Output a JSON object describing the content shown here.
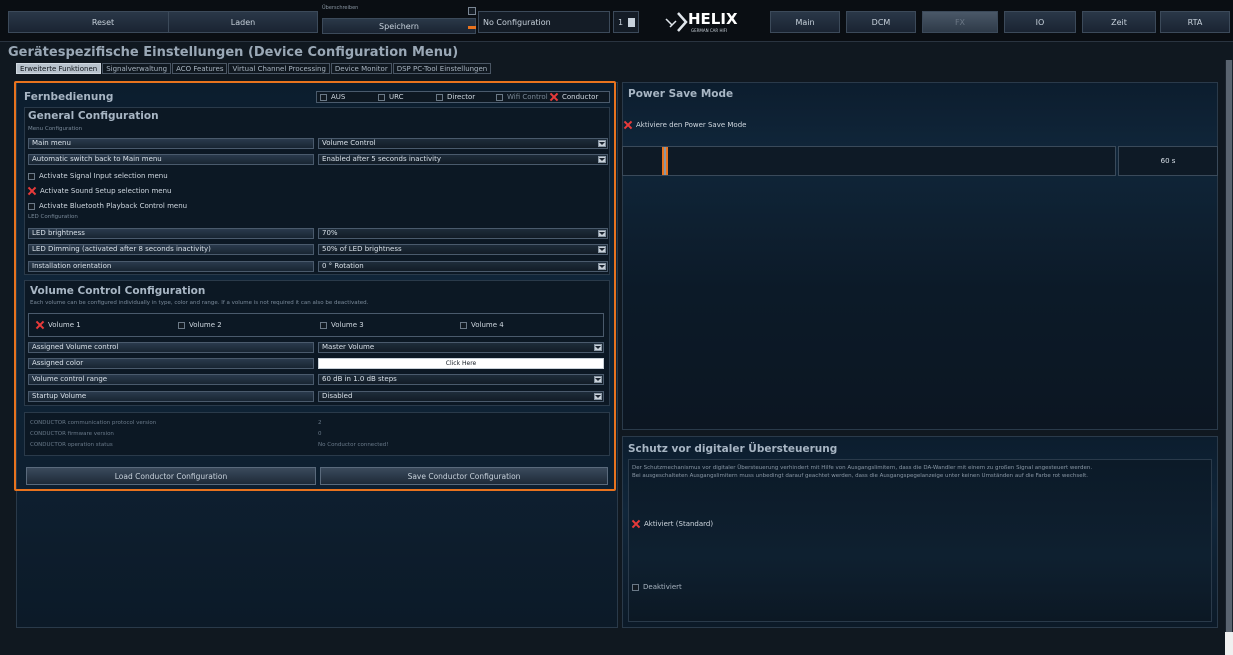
{
  "toolbar": {
    "reset": "Reset",
    "laden": "Laden",
    "overwrite_label": "Überschreiben",
    "speichern": "Speichern",
    "config_name": "No Configuration",
    "config_number": "1",
    "logo_main": "HELIX",
    "logo_sub": "GERMAN CAR HIFI",
    "nav": [
      "Main",
      "DCM",
      "FX",
      "IO",
      "Zeit",
      "RTA"
    ]
  },
  "page_title": "Gerätespezifische Einstellungen (Device Configuration Menu)",
  "tabs": [
    "Erweiterte Funktionen",
    "Signalverwaltung",
    "ACO Features",
    "Virtual Channel Processing",
    "Device Monitor",
    "DSP PC-Tool Einstellungen"
  ],
  "remote": {
    "title": "Fernbedienung",
    "options": [
      {
        "label": "AUS",
        "checked": false
      },
      {
        "label": "URC",
        "checked": false
      },
      {
        "label": "Director",
        "checked": false
      },
      {
        "label": "Wifi Control",
        "checked": false
      },
      {
        "label": "Conductor",
        "checked": true
      }
    ]
  },
  "general": {
    "title": "General Configuration",
    "menu_sub": "Menu Configuration",
    "rows": [
      {
        "label": "Main menu",
        "value": "Volume Control"
      },
      {
        "label": "Automatic switch back to Main menu",
        "value": "Enabled after 5 seconds inactivity"
      }
    ],
    "checks": [
      {
        "label": "Activate Signal Input selection menu",
        "checked": false
      },
      {
        "label": "Activate Sound Setup selection menu",
        "checked": true
      },
      {
        "label": "Activate Bluetooth Playback Control menu",
        "checked": false
      }
    ],
    "led_sub": "LED Configuration",
    "led_rows": [
      {
        "label": "LED brightness",
        "value": "70%"
      },
      {
        "label": "LED Dimming (activated after 8 seconds inactivity)",
        "value": "50% of LED brightness"
      },
      {
        "label": "Installation orientation",
        "value": "0 ° Rotation"
      }
    ]
  },
  "volume": {
    "title": "Volume Control Configuration",
    "sub": "Each volume can be configured individually in type, color and range. If a volume is not required it can also be deactivated.",
    "volumes": [
      {
        "label": "Volume 1",
        "checked": true
      },
      {
        "label": "Volume 2",
        "checked": false
      },
      {
        "label": "Volume 3",
        "checked": false
      },
      {
        "label": "Volume 4",
        "checked": false
      }
    ],
    "assigned_control_label": "Assigned Volume control",
    "assigned_control_value": "Master Volume",
    "assigned_color_label": "Assigned color",
    "assigned_color_value": "Click Here",
    "range_label": "Volume control range",
    "range_value": "60 dB in 1.0 dB steps",
    "startup_label": "Startup Volume",
    "startup_value": "Disabled"
  },
  "conductor_info": {
    "protocol_label": "CONDUCTOR communication protocol version",
    "protocol_value": "2",
    "firmware_label": "CONDUCTOR firmware version",
    "firmware_value": "0",
    "status_label": "CONDUCTOR operation status",
    "status_value": "No Conductor connected!"
  },
  "buttons": {
    "load": "Load Conductor Configuration",
    "save": "Save Conductor Configuration"
  },
  "power_save": {
    "title": "Power Save Mode",
    "activate_label": "Aktiviere den Power Save Mode",
    "activate_checked": true,
    "slider_value": "60 s",
    "slider_fraction": 0.08
  },
  "overdrive": {
    "title": "Schutz vor digitaler Übersteuerung",
    "desc1": "Der Schutzmechanismus vor digitaler Übersteuerung verhindert mit Hilfe von Ausgangslimitern, dass die DA-Wandler mit einem zu großen Signal angesteuert werden.",
    "desc2": "Bei ausgeschalteten Ausgangslimitern muss unbedingt darauf geachtet werden, dass die Ausgangspegelanzeige unter keinen Umständen auf die Farbe rot wechselt.",
    "active_label": "Aktiviert (Standard)",
    "active_checked": true,
    "inactive_label": "Deaktiviert",
    "inactive_checked": false
  }
}
